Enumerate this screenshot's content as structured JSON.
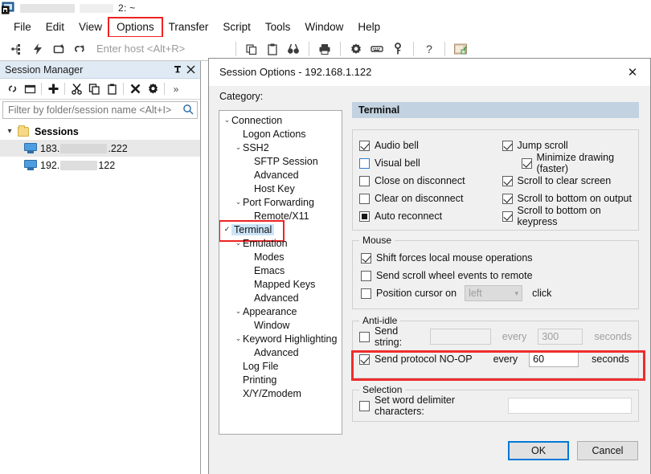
{
  "window": {
    "title_suffix": "2: ~",
    "icon": "securecrt-icon"
  },
  "menu": {
    "items": [
      {
        "label": "File",
        "highlight": false
      },
      {
        "label": "Edit",
        "highlight": false
      },
      {
        "label": "View",
        "highlight": false
      },
      {
        "label": "Options",
        "highlight": true
      },
      {
        "label": "Transfer",
        "highlight": false
      },
      {
        "label": "Script",
        "highlight": false
      },
      {
        "label": "Tools",
        "highlight": false
      },
      {
        "label": "Window",
        "highlight": false
      },
      {
        "label": "Help",
        "highlight": false
      }
    ]
  },
  "toolbar": {
    "host_placeholder": "Enter host <Alt+R>",
    "icons": [
      "connect-icon",
      "quick-connect-icon",
      "reconnect-icon",
      "disconnect-icon",
      "copy-icon",
      "paste-icon",
      "find-icon",
      "print-icon",
      "settings-icon",
      "keyboard-icon",
      "key-icon",
      "help-icon",
      "session-options-icon"
    ]
  },
  "session_manager": {
    "title": "Session Manager",
    "pin_icon": "pin-icon",
    "close_icon": "close-icon",
    "toolbar_icons": [
      "link-icon",
      "new-folder-icon",
      "add-icon",
      "cut-icon",
      "copy-icon",
      "paste-icon",
      "delete-icon",
      "properties-icon",
      "overflow-icon"
    ],
    "overflow_label": "»",
    "filter_placeholder": "Filter by folder/session name <Alt+I>",
    "search_icon": "search-icon",
    "root": {
      "label": "Sessions",
      "expanded": true
    },
    "sessions": [
      {
        "label_prefix": "183.",
        "label_suffix": ".222",
        "selected": true
      },
      {
        "label_prefix": "192.",
        "label_suffix": "122",
        "selected": false
      }
    ]
  },
  "dialog": {
    "title": "Session Options - 192.168.1.122",
    "close_label": "✕",
    "category_label": "Category:",
    "category_tree": [
      {
        "label": "Connection",
        "indent": 0,
        "chevron": "⌄",
        "selected": false
      },
      {
        "label": "Logon Actions",
        "indent": 1,
        "chevron": "",
        "selected": false
      },
      {
        "label": "SSH2",
        "indent": 1,
        "chevron": "⌄",
        "selected": false
      },
      {
        "label": "SFTP Session",
        "indent": 2,
        "chevron": "",
        "selected": false
      },
      {
        "label": "Advanced",
        "indent": 2,
        "chevron": "",
        "selected": false
      },
      {
        "label": "Host Key",
        "indent": 2,
        "chevron": "",
        "selected": false
      },
      {
        "label": "Port Forwarding",
        "indent": 1,
        "chevron": "⌄",
        "selected": false
      },
      {
        "label": "Remote/X11",
        "indent": 2,
        "chevron": "",
        "selected": false
      },
      {
        "label": "Terminal",
        "indent": 0,
        "chevron": "✓",
        "selected": true
      },
      {
        "label": "Emulation",
        "indent": 1,
        "chevron": "⌄",
        "selected": false
      },
      {
        "label": "Modes",
        "indent": 2,
        "chevron": "",
        "selected": false
      },
      {
        "label": "Emacs",
        "indent": 2,
        "chevron": "",
        "selected": false
      },
      {
        "label": "Mapped Keys",
        "indent": 2,
        "chevron": "",
        "selected": false
      },
      {
        "label": "Advanced",
        "indent": 2,
        "chevron": "",
        "selected": false
      },
      {
        "label": "Appearance",
        "indent": 1,
        "chevron": "⌄",
        "selected": false
      },
      {
        "label": "Window",
        "indent": 2,
        "chevron": "",
        "selected": false
      },
      {
        "label": "Keyword Highlighting",
        "indent": 1,
        "chevron": "⌄",
        "selected": false
      },
      {
        "label": "Advanced",
        "indent": 2,
        "chevron": "",
        "selected": false
      },
      {
        "label": "Log File",
        "indent": 1,
        "chevron": "",
        "selected": false
      },
      {
        "label": "Printing",
        "indent": 1,
        "chevron": "",
        "selected": false
      },
      {
        "label": "X/Y/Zmodem",
        "indent": 1,
        "chevron": "",
        "selected": false
      }
    ],
    "pane_title": "Terminal",
    "general": {
      "left": [
        {
          "label": "Audio bell",
          "state": "checked"
        },
        {
          "label": "Visual bell",
          "state": "unchecked-blue"
        },
        {
          "label": "Close on disconnect",
          "state": "unchecked"
        },
        {
          "label": "Clear on disconnect",
          "state": "unchecked"
        },
        {
          "label": "Auto reconnect",
          "state": "indeterminate"
        }
      ],
      "right": [
        {
          "label": "Jump scroll",
          "state": "checked",
          "indent": false
        },
        {
          "label": "Minimize drawing (faster)",
          "state": "checked",
          "indent": true
        },
        {
          "label": "Scroll to clear screen",
          "state": "checked",
          "indent": false
        },
        {
          "label": "Scroll to bottom on output",
          "state": "checked",
          "indent": false
        },
        {
          "label": "Scroll to bottom on keypress",
          "state": "checked",
          "indent": false
        }
      ]
    },
    "mouse": {
      "legend": "Mouse",
      "shift_forces": {
        "label": "Shift forces local mouse operations",
        "state": "checked"
      },
      "send_scroll": {
        "label": "Send scroll wheel events to remote",
        "state": "unchecked"
      },
      "position_cursor": {
        "label": "Position cursor on",
        "state": "unchecked"
      },
      "position_combo_value": "left",
      "position_suffix": "click"
    },
    "anti_idle": {
      "legend": "Anti-idle",
      "send_string": {
        "label": "Send string:",
        "state": "unchecked"
      },
      "send_string_value": "",
      "send_string_every": "every",
      "send_string_interval": "300",
      "send_string_units": "seconds",
      "no_op": {
        "label": "Send protocol NO-OP",
        "state": "checked"
      },
      "no_op_every": "every",
      "no_op_interval": "60",
      "no_op_units": "seconds"
    },
    "selection": {
      "legend": "Selection",
      "word_delim": {
        "label": "Set word delimiter characters:",
        "state": "unchecked"
      },
      "word_delim_value": ""
    },
    "buttons": {
      "ok": "OK",
      "cancel": "Cancel"
    }
  },
  "colors": {
    "highlight_red": "#ee2d2d",
    "pane_header": "#c2d2e0",
    "dialog_bg": "#f0f0f0",
    "focus_blue": "#0078d7",
    "selection_blue": "#cce4f7",
    "sm_header": "#dfeaf4"
  }
}
